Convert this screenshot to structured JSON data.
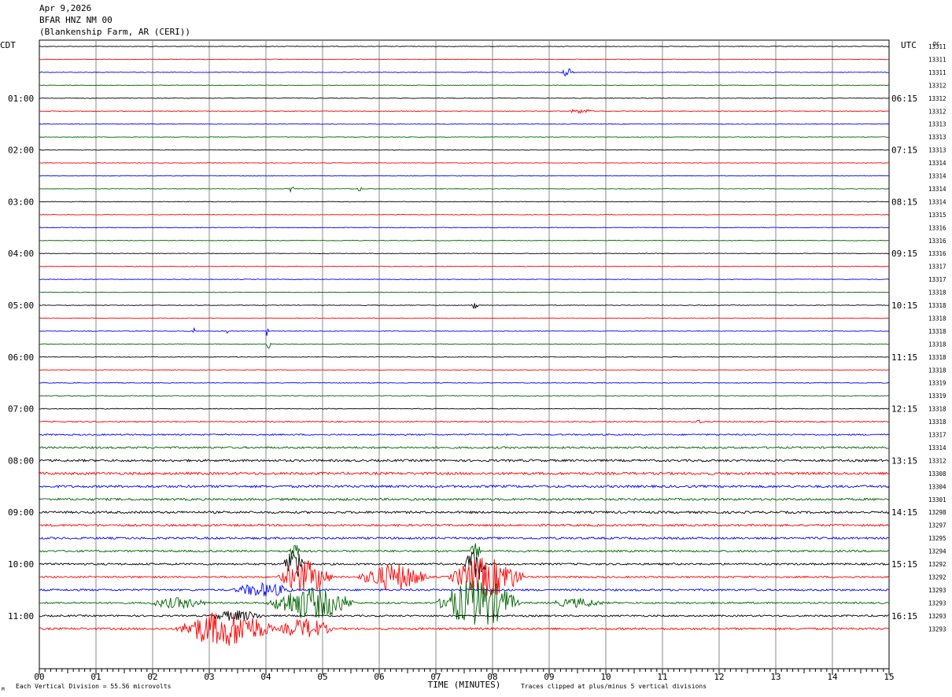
{
  "header": {
    "date": "Apr 9,2026",
    "station": "BFAR HNZ NM 00",
    "location": "(Blankenship Farm, AR (CERI))"
  },
  "chart_data": {
    "type": "line",
    "title": "BFAR HNZ NM 00",
    "left_axis_label": "CDT",
    "right_axis_label": "UTC",
    "dc_label": "DC",
    "xlabel": "TIME (MINUTES)",
    "xlim": [
      0,
      15
    ],
    "x_ticks": [
      "00",
      "01",
      "02",
      "03",
      "04",
      "05",
      "06",
      "07",
      "08",
      "09",
      "10",
      "11",
      "12",
      "13",
      "14",
      "15"
    ],
    "left_hour_labels": [
      "01:00",
      "02:00",
      "03:00",
      "04:00",
      "05:00",
      "06:00",
      "07:00",
      "08:00",
      "09:00",
      "10:00",
      "11:00"
    ],
    "right_hour_labels": [
      "06:15",
      "07:15",
      "08:15",
      "09:15",
      "10:15",
      "11:15",
      "12:15",
      "13:15",
      "14:15",
      "15:15",
      "16:15"
    ],
    "trace_colors": [
      "#000000",
      "#ff0000",
      "#0000ff",
      "#006400"
    ],
    "dc_values": [
      13311,
      13311,
      13311,
      13312,
      13312,
      13312,
      13313,
      13313,
      13313,
      13314,
      13314,
      13314,
      13314,
      13315,
      13316,
      13316,
      13316,
      13317,
      13317,
      13318,
      13318,
      13318,
      13318,
      13318,
      13318,
      13318,
      13319,
      13319,
      13318,
      13318,
      13317,
      13314,
      13312,
      13308,
      13304,
      13301,
      13298,
      13297,
      13295,
      13294,
      13292,
      13292,
      13293,
      13293,
      13293,
      13293
    ],
    "noise_levels": [
      0.4,
      0.4,
      0.4,
      0.4,
      0.4,
      0.4,
      0.4,
      0.4,
      0.4,
      0.4,
      0.4,
      0.4,
      0.4,
      0.4,
      0.4,
      0.4,
      0.4,
      0.4,
      0.4,
      0.4,
      0.4,
      0.4,
      0.4,
      0.4,
      0.4,
      0.4,
      0.5,
      0.5,
      0.5,
      0.7,
      0.9,
      1.2,
      1.4,
      1.6,
      1.5,
      1.4,
      1.4,
      1.3,
      1.3,
      1.2,
      1.2,
      1.1,
      1.2,
      1.1,
      1.1,
      1.3
    ],
    "footer_left": "Each Vertical Division =   55.56 microvolts",
    "footer_right": "Traces clipped at plus/minus 5 vertical divisions",
    "corner_mark": "M"
  }
}
